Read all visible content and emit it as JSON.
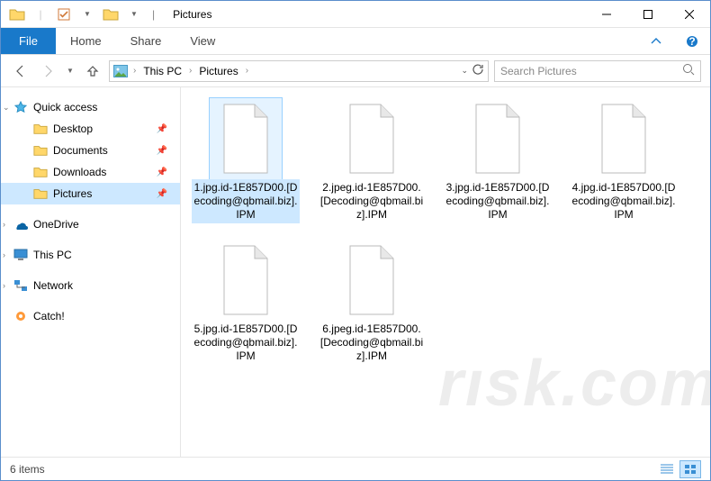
{
  "titlebar": {
    "app_title": "Pictures",
    "separator": "|"
  },
  "ribbon": {
    "file": "File",
    "tabs": [
      "Home",
      "Share",
      "View"
    ]
  },
  "nav": {
    "breadcrumb": [
      "This PC",
      "Pictures"
    ],
    "search_placeholder": "Search Pictures"
  },
  "sidebar": {
    "quick_access": "Quick access",
    "quick_items": [
      {
        "label": "Desktop",
        "pinned": true
      },
      {
        "label": "Documents",
        "pinned": true
      },
      {
        "label": "Downloads",
        "pinned": true
      },
      {
        "label": "Pictures",
        "pinned": true,
        "selected": true
      }
    ],
    "onedrive": "OneDrive",
    "this_pc": "This PC",
    "network": "Network",
    "catch": "Catch!"
  },
  "files": [
    {
      "name": "1.jpg.id-1E857D00.[Decoding@qbmail.biz].IPM",
      "selected": true
    },
    {
      "name": "2.jpeg.id-1E857D00.[Decoding@qbmail.biz].IPM"
    },
    {
      "name": "3.jpg.id-1E857D00.[Decoding@qbmail.biz].IPM"
    },
    {
      "name": "4.jpg.id-1E857D00.[Decoding@qbmail.biz].IPM"
    },
    {
      "name": "5.jpg.id-1E857D00.[Decoding@qbmail.biz].IPM"
    },
    {
      "name": "6.jpeg.id-1E857D00.[Decoding@qbmail.biz].IPM"
    }
  ],
  "status": {
    "item_count": "6 items"
  }
}
